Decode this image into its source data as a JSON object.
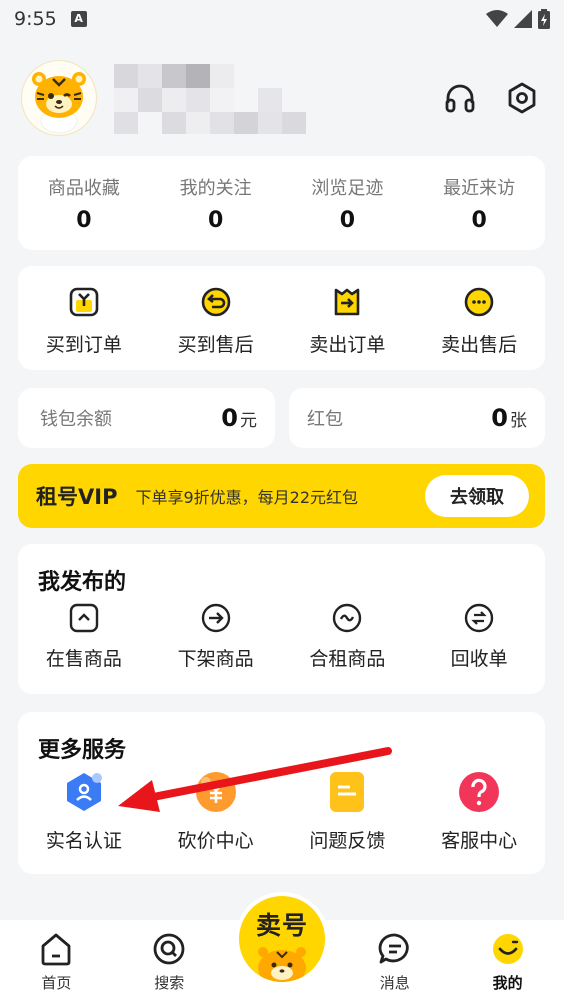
{
  "status_bar": {
    "time": "9:55",
    "notification_badge": "A"
  },
  "stats": [
    {
      "label": "商品收藏",
      "value": "0"
    },
    {
      "label": "我的关注",
      "value": "0"
    },
    {
      "label": "浏览足迹",
      "value": "0"
    },
    {
      "label": "最近来访",
      "value": "0"
    }
  ],
  "orders": [
    {
      "label": "买到订单",
      "icon": "bag-icon"
    },
    {
      "label": "买到售后",
      "icon": "return-icon"
    },
    {
      "label": "卖出订单",
      "icon": "arrow-bag-icon"
    },
    {
      "label": "卖出售后",
      "icon": "dots-icon"
    }
  ],
  "wallet": {
    "label": "钱包余额",
    "amount": "0",
    "unit": "元"
  },
  "redpack": {
    "label": "红包",
    "amount": "0",
    "unit": "张"
  },
  "vip": {
    "title": "租号VIP",
    "desc": "下单享9折优惠，每月22元红包",
    "button": "去领取"
  },
  "published": {
    "title": "我发布的",
    "items": [
      {
        "label": "在售商品",
        "icon": "up-icon"
      },
      {
        "label": "下架商品",
        "icon": "arrow-right-circle-icon"
      },
      {
        "label": "合租商品",
        "icon": "wave-icon"
      },
      {
        "label": "回收单",
        "icon": "swap-icon"
      }
    ]
  },
  "more": {
    "title": "更多服务",
    "items": [
      {
        "label": "实名认证",
        "icon": "id-shield-icon"
      },
      {
        "label": "砍价中心",
        "icon": "yuan-icon"
      },
      {
        "label": "问题反馈",
        "icon": "feedback-doc-icon"
      },
      {
        "label": "客服中心",
        "icon": "question-icon"
      }
    ]
  },
  "tabbar": {
    "home": "首页",
    "search": "搜索",
    "sell": "卖号",
    "messages": "消息",
    "mine": "我的"
  },
  "colors": {
    "accent": "#ffd600",
    "background": "#f4f5f7",
    "annotation_arrow": "#e8161b"
  }
}
